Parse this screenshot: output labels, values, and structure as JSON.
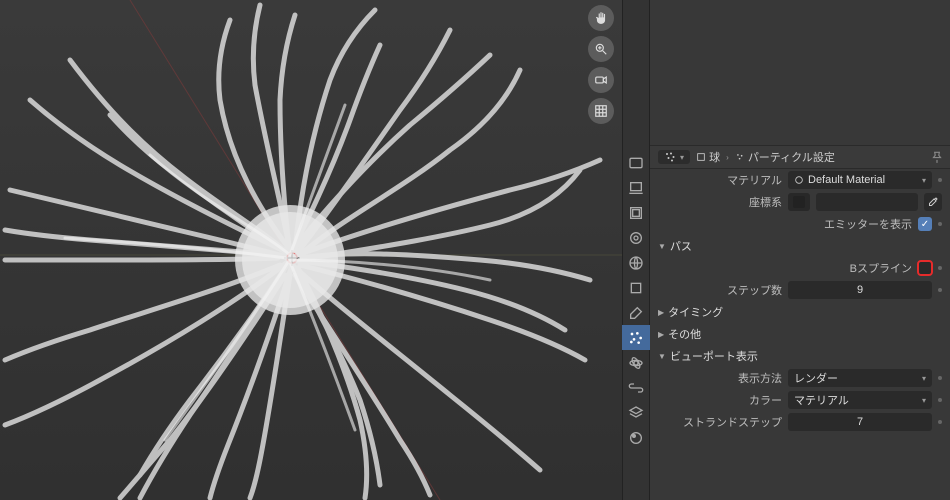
{
  "breadcrumb": {
    "context_icon": "particles-icon",
    "object_label": "球",
    "settings_label": "パーティクル設定"
  },
  "properties": {
    "material": {
      "label": "マテリアル",
      "value": "Default Material"
    },
    "coord": {
      "label": "座標系"
    },
    "show_emitter": {
      "label": "エミッターを表示",
      "checked": true
    },
    "panel_path": {
      "label": "パス"
    },
    "bspline": {
      "label": "Bスプライン",
      "checked": false,
      "highlighted": true
    },
    "steps": {
      "label": "ステップ数",
      "value": "9"
    },
    "panel_timing": {
      "label": "タイミング"
    },
    "panel_other": {
      "label": "その他"
    },
    "panel_viewport": {
      "label": "ビューポート表示"
    },
    "display_as": {
      "label": "表示方法",
      "value": "レンダー"
    },
    "draw_color": {
      "label": "カラー",
      "value": "マテリアル"
    },
    "strand": {
      "label": "ストランドステップ",
      "value": "7"
    }
  },
  "nav_icons": [
    "hand-icon",
    "zoom-icon",
    "camera-icon",
    "grid-icon"
  ],
  "toolstrip_icons": [
    "tool-render-icon",
    "tool-output-icon",
    "tool-viewlayer-icon",
    "tool-scene-icon",
    "tool-world-icon",
    "tool-object-icon",
    "tool-modifier-icon",
    "tool-particles-icon",
    "tool-physics-icon",
    "tool-constraint-icon",
    "tool-data-icon",
    "tool-material-icon"
  ],
  "toolstrip_active_index": 7
}
